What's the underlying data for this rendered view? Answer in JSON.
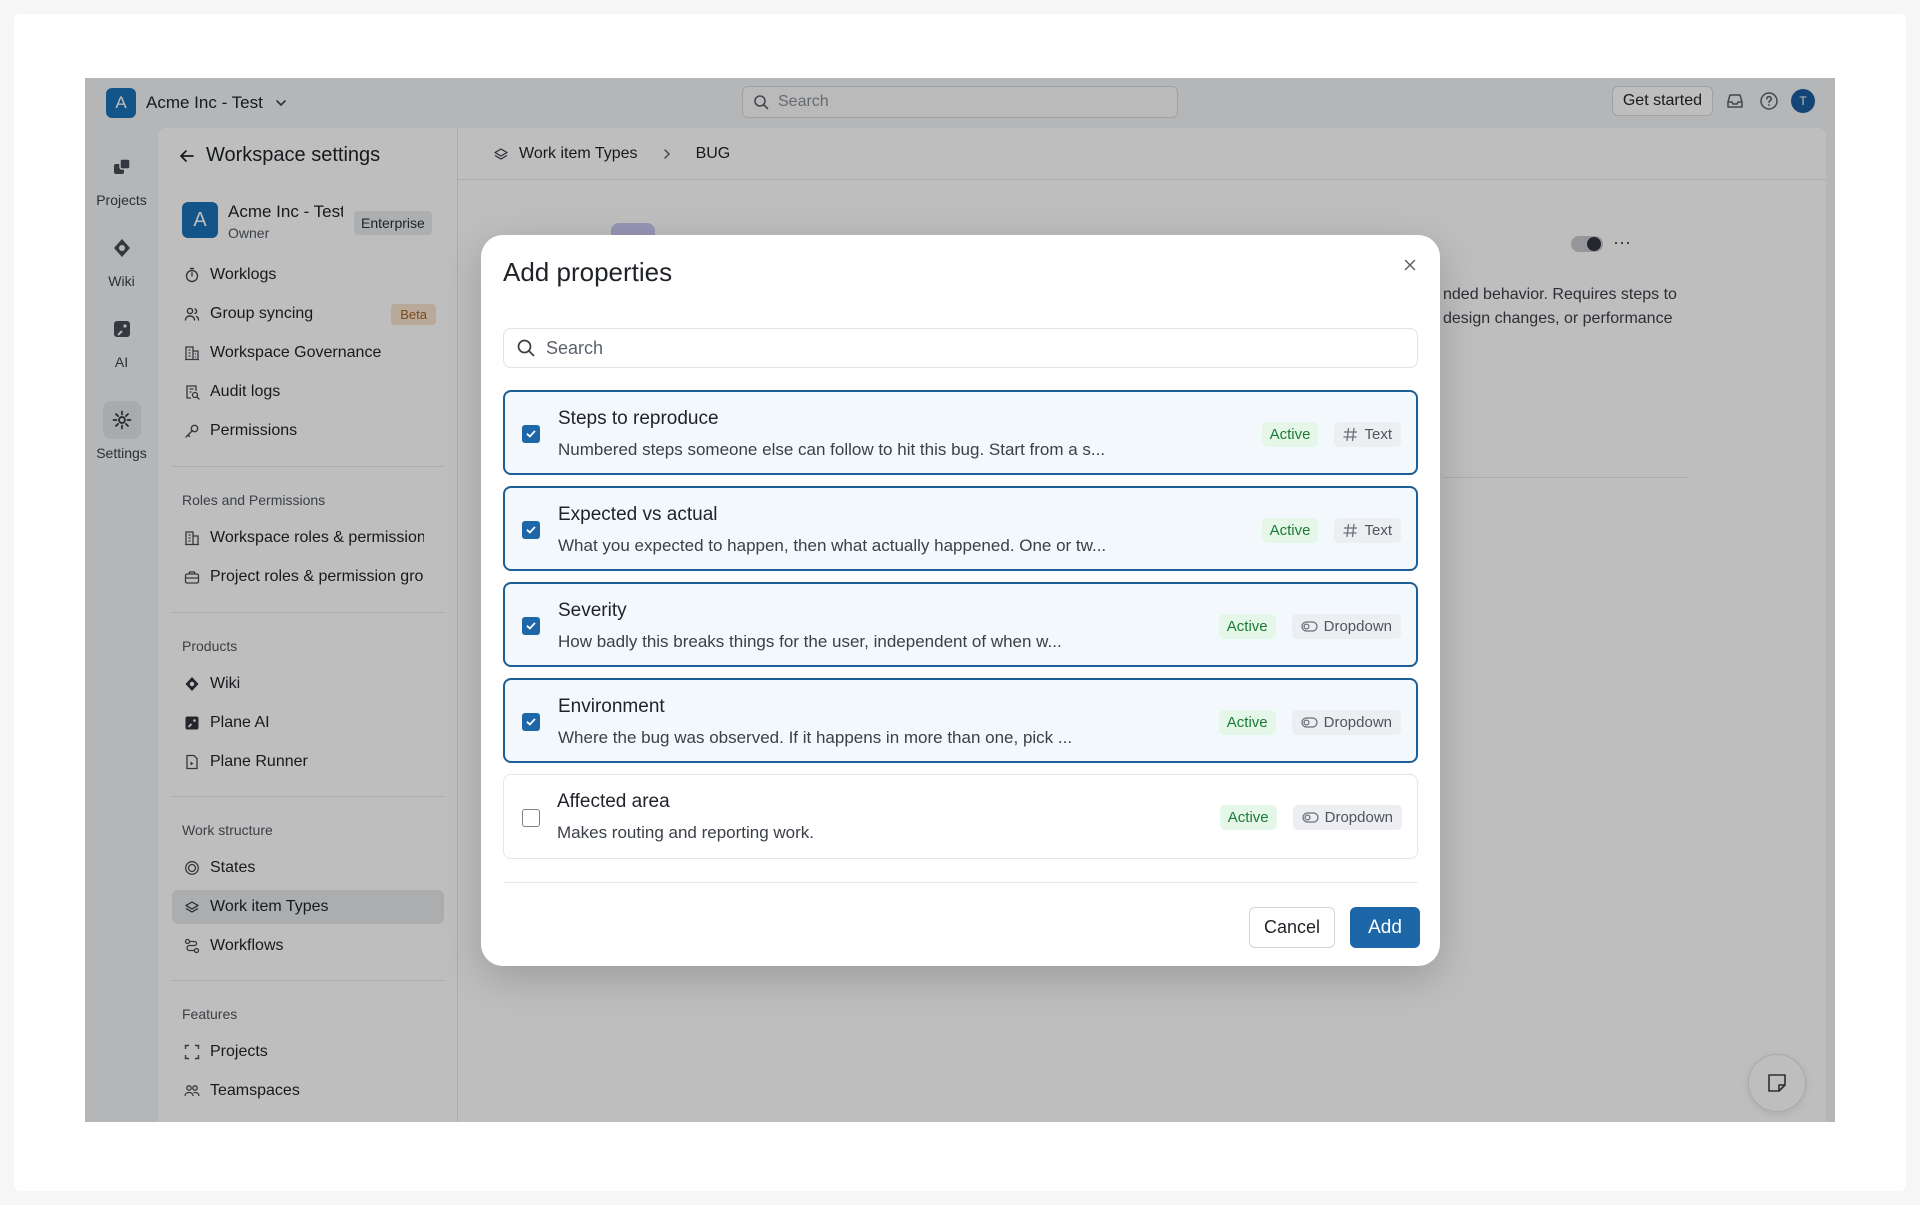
{
  "topbar": {
    "workspace_initial": "A",
    "workspace_name": "Acme Inc - Test",
    "search_placeholder": "Search",
    "get_started": "Get started",
    "avatar_initial": "T"
  },
  "rail": {
    "items": [
      {
        "label": "Projects",
        "icon": "projects-icon"
      },
      {
        "label": "Wiki",
        "icon": "wiki-icon"
      },
      {
        "label": "AI",
        "icon": "ai-icon"
      },
      {
        "label": "Settings",
        "icon": "gear-icon",
        "active": true
      }
    ]
  },
  "sidebar": {
    "title": "Workspace settings",
    "account": {
      "initial": "A",
      "name": "Acme Inc - Test",
      "role": "Owner",
      "plan": "Enterprise"
    },
    "group1": [
      {
        "label": "Worklogs",
        "icon": "timer-icon"
      },
      {
        "label": "Group syncing",
        "icon": "users-icon",
        "badge": "Beta"
      },
      {
        "label": "Workspace Governance",
        "icon": "building-icon"
      },
      {
        "label": "Audit logs",
        "icon": "audit-icon"
      },
      {
        "label": "Permissions",
        "icon": "key-icon"
      }
    ],
    "roles_heading": "Roles and Permissions",
    "roles": [
      {
        "label": "Workspace roles & permission groups",
        "icon": "building-icon"
      },
      {
        "label": "Project roles & permission groups",
        "icon": "briefcase-icon"
      }
    ],
    "products_heading": "Products",
    "products": [
      {
        "label": "Wiki",
        "icon": "wiki-icon"
      },
      {
        "label": "Plane AI",
        "icon": "ai-icon"
      },
      {
        "label": "Plane Runner",
        "icon": "runner-icon"
      }
    ],
    "structure_heading": "Work structure",
    "structure": [
      {
        "label": "States",
        "icon": "states-icon"
      },
      {
        "label": "Work item Types",
        "icon": "types-icon",
        "active": true
      },
      {
        "label": "Workflows",
        "icon": "workflow-icon"
      }
    ],
    "features_heading": "Features",
    "features": [
      {
        "label": "Projects",
        "icon": "projects-icon"
      },
      {
        "label": "Teamspaces",
        "icon": "teams-icon"
      }
    ]
  },
  "breadcrumb": {
    "parent": "Work item Types",
    "current": "BUG"
  },
  "background_description": {
    "line1": "nded behavior. Requires steps to",
    "line2": "design changes, or performance"
  },
  "modal": {
    "title": "Add properties",
    "search_placeholder": "Search",
    "properties": [
      {
        "name": "Steps to reproduce",
        "description": "Numbered steps someone else can follow to hit this bug. Start from a s...",
        "status": "Active",
        "type": "Text",
        "type_icon": "hash-icon",
        "checked": true
      },
      {
        "name": "Expected vs actual",
        "description": "What you expected to happen, then what actually happened. One or tw...",
        "status": "Active",
        "type": "Text",
        "type_icon": "hash-icon",
        "checked": true
      },
      {
        "name": "Severity",
        "description": "How badly this breaks things for the user, independent of when w...",
        "status": "Active",
        "type": "Dropdown",
        "type_icon": "toggle-icon",
        "checked": true
      },
      {
        "name": "Environment",
        "description": "Where the bug was observed. If it happens in more than one, pick ...",
        "status": "Active",
        "type": "Dropdown",
        "type_icon": "toggle-icon",
        "checked": true
      },
      {
        "name": "Affected area",
        "description": "Makes routing and reporting work.",
        "status": "Active",
        "type": "Dropdown",
        "type_icon": "toggle-icon",
        "checked": false
      }
    ],
    "cancel_label": "Cancel",
    "add_label": "Add"
  },
  "colors": {
    "accent": "#1d66a8",
    "active_tag_bg": "#e4f7e8",
    "active_tag_text": "#1d7a35",
    "beta_bg": "#f7e3cf"
  }
}
